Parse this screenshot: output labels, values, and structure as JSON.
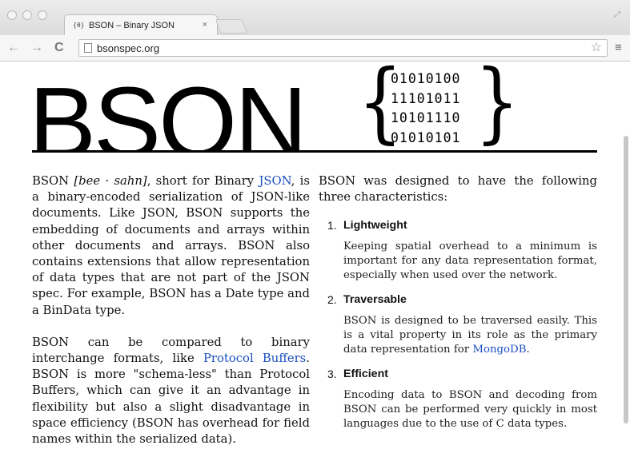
{
  "browser": {
    "tab_favicon": "{θ}",
    "tab_title": "BSON – Binary JSON",
    "tab_close": "×",
    "url": "bsonspec.org",
    "back_glyph": "←",
    "forward_glyph": "→",
    "reload_glyph": "C",
    "star_glyph": "☆",
    "menu_glyph": "≡",
    "resize_glyph": "⤢"
  },
  "logo": {
    "word": "BSON",
    "open_brace": "{",
    "close_brace": "}",
    "bits": [
      "01010100",
      "11101011",
      "10101110",
      "01010101"
    ]
  },
  "left_column": {
    "p1": {
      "t1": "BSON ",
      "pronunciation": "[bee · sahn]",
      "t2": ", short for Binary ",
      "json_link": "JSON",
      "t3": ", is a binary-encoded serialization of JSON-like documents. Like JSON, BSON supports the embedding of documents and arrays within other documents and arrays. BSON also contains extensions that allow representation of data types that are not part of the JSON spec. For example, BSON has a Date type and a BinData type."
    },
    "p2": {
      "t1": "BSON can be compared to binary interchange formats, like ",
      "protobuf_link": "Protocol Buffers",
      "t2": ". BSON is more \"schema-less\" than Protocol Buffers, which can give it an advantage in flexibility but also a slight disadvantage in space efficiency (BSON has overhead for field names within the serialized data)."
    }
  },
  "right_column": {
    "intro": "BSON was designed to have the following three characteristics:",
    "features": [
      {
        "num": "1.",
        "title": "Lightweight",
        "body": "Keeping spatial overhead to a minimum is important for any data representation format, especially when used over the network."
      },
      {
        "num": "2.",
        "title": "Traversable",
        "body": "BSON is designed to be traversed easily. This is a vital property in its role as the primary data representation for ",
        "link": "MongoDB",
        "tail": "."
      },
      {
        "num": "3.",
        "title": "Efficient",
        "body": "Encoding data to BSON and decoding from BSON can be performed very quickly in most languages due to the use of C data types."
      }
    ]
  },
  "colors": {
    "link": "#1a4fc1",
    "text": "#111111"
  }
}
